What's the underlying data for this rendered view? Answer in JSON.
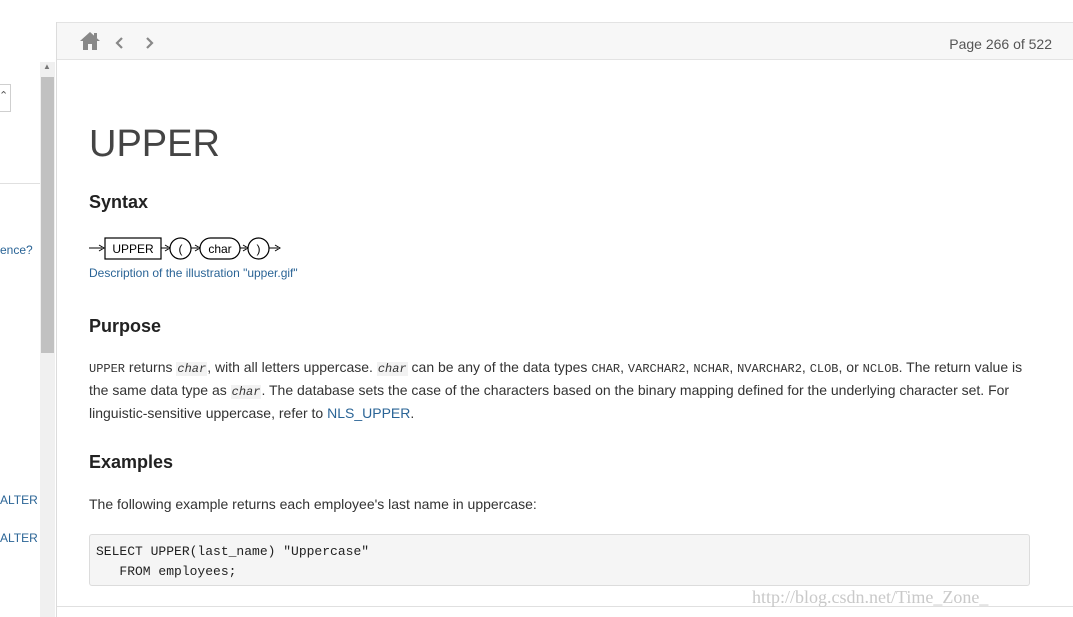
{
  "toolbar": {
    "page_info": "Page 266 of 522"
  },
  "left_panel": {
    "box_glyph": "⌃",
    "links": [
      "ence?",
      "ALTER",
      "ALTER"
    ]
  },
  "article": {
    "title": "UPPER",
    "syntax_heading": "Syntax",
    "diagram": {
      "keyword": "UPPER",
      "open_paren": "(",
      "arg": "char",
      "close_paren": ")"
    },
    "diagram_link": "Description of the illustration \"upper.gif\"",
    "purpose_heading": "Purpose",
    "purpose": {
      "t1": "UPPER",
      "t2": " returns ",
      "t3": "char",
      "t4": ", with all letters uppercase. ",
      "t5": "char",
      "t6": " can be any of the data types ",
      "t7": "CHAR",
      "t8": ", ",
      "t9": "VARCHAR2",
      "t10": ", ",
      "t11": "NCHAR",
      "t12": ", ",
      "t13": "NVARCHAR2",
      "t14": ", ",
      "t15": "CLOB",
      "t16": ", or ",
      "t17": "NCLOB",
      "t18": ". The return value is the same data type as ",
      "t19": "char",
      "t20": ". The database sets the case of the characters based on the binary mapping defined for the underlying character set. For linguistic-sensitive uppercase, refer to ",
      "t21": "NLS_UPPER",
      "t22": "."
    },
    "examples_heading": "Examples",
    "examples_intro": "The following example returns each employee's last name in uppercase:",
    "code_lines": [
      "SELECT UPPER(last_name) \"Uppercase\"",
      "   FROM employees;"
    ]
  },
  "watermark": "http://blog.csdn.net/Time_Zone_"
}
